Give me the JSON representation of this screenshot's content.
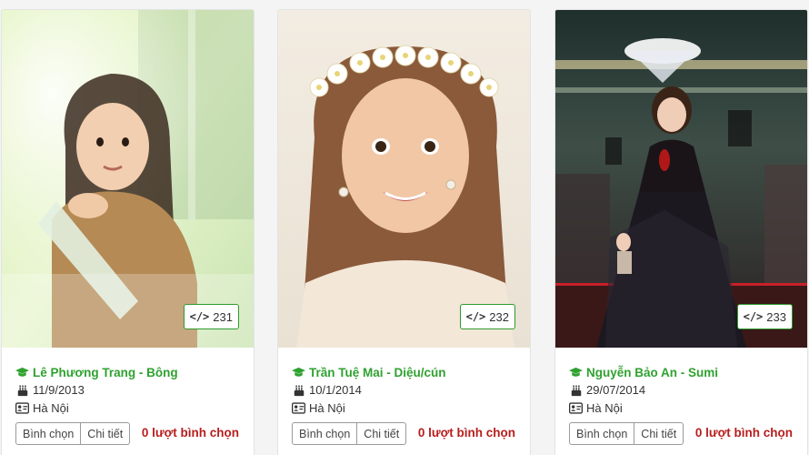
{
  "colors": {
    "name": "#2fa12f",
    "votes": "#b81d1d",
    "badge_border": "#2e9a2e"
  },
  "icons": {
    "graduate": "graduation-cap-icon",
    "birthday": "birthday-cake-icon",
    "location": "id-card-icon",
    "code": "code-icon"
  },
  "cards": [
    {
      "name": "Lê Phương Trang - Bông",
      "birthdate": "11/9/2013",
      "city": "Hà Nội",
      "code": "231",
      "vote_label": "Bình chọn",
      "detail_label": "Chi tiết",
      "votes": "0 lượt bình chọn"
    },
    {
      "name": "Trần Tuệ Mai - Diệu/cún",
      "birthdate": "10/1/2014",
      "city": "Hà Nội",
      "code": "232",
      "vote_label": "Bình chọn",
      "detail_label": "Chi tiết",
      "votes": "0 lượt bình chọn"
    },
    {
      "name": "Nguyễn Bảo An - Sumi",
      "birthdate": "29/07/2014",
      "city": "Hà Nội",
      "code": "233",
      "vote_label": "Bình chọn",
      "detail_label": "Chi tiết",
      "votes": "0 lượt bình chọn"
    }
  ]
}
